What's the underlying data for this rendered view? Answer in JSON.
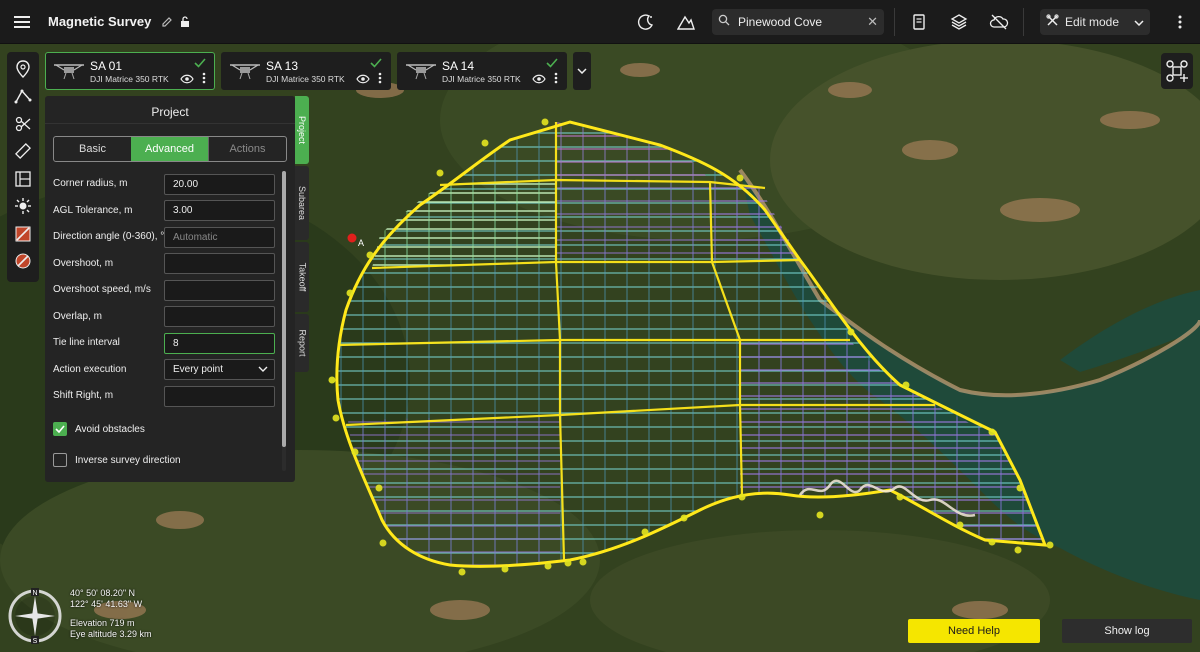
{
  "header": {
    "project_title": "Magnetic Survey",
    "search_value": "Pinewood Cove",
    "edit_mode_label": "Edit mode"
  },
  "icons": {
    "menu": "menu-icon",
    "edit": "pencil-icon",
    "lock": "lock-icon",
    "night": "moon-stars-icon",
    "terrain": "mountain-icon",
    "search": "search-icon",
    "clear": "close-icon",
    "doc": "document-icon",
    "layers": "layers-icon",
    "offline": "cloud-off-icon",
    "edit_mode": "tools-icon",
    "more": "more-vert-icon"
  },
  "drones": [
    {
      "name": "SA 01",
      "model": "DJI Matrice 350 RTK",
      "active": true
    },
    {
      "name": "SA 13",
      "model": "DJI Matrice 350 RTK",
      "active": false
    },
    {
      "name": "SA 14",
      "model": "DJI Matrice 350 RTK",
      "active": false
    }
  ],
  "panel": {
    "title": "Project",
    "tabs": [
      "Basic",
      "Advanced",
      "Actions"
    ],
    "active_tab": "Advanced",
    "fields": {
      "corner_radius": {
        "label": "Corner radius, m",
        "value": "20.00"
      },
      "agl_tolerance": {
        "label": "AGL Tolerance, m",
        "value": "3.00"
      },
      "direction_angle": {
        "label": "Direction angle (0-360), °",
        "placeholder": "Automatic"
      },
      "overshoot": {
        "label": "Overshoot, m",
        "value": ""
      },
      "overshoot_speed": {
        "label": "Overshoot speed, m/s",
        "value": ""
      },
      "overlap": {
        "label": "Overlap, m",
        "value": ""
      },
      "tie_line_interval": {
        "label": "Tie line interval",
        "value": "8"
      },
      "action_execution": {
        "label": "Action execution",
        "value": "Every point"
      },
      "shift_right": {
        "label": "Shift Right, m",
        "value": ""
      }
    },
    "checkboxes": {
      "avoid_obstacles": {
        "label": "Avoid obstacles",
        "checked": true
      },
      "inverse_direction": {
        "label": "Inverse survey direction",
        "checked": false
      }
    }
  },
  "side_tabs": [
    "Project",
    "Subarea",
    "Takeoff",
    "Report"
  ],
  "map": {
    "marker_label": "A",
    "colors": {
      "boundary": "#ffe81a",
      "accent": "#4caf50",
      "water": "#1f4f3c"
    }
  },
  "position": {
    "latitude": "40° 50' 08.20\" N",
    "longitude": "122° 45' 41.63\" W",
    "elevation": "Elevation 719 m",
    "eye_altitude": "Eye altitude 3.29 km"
  },
  "footer": {
    "help_label": "Need Help",
    "log_label": "Show log"
  }
}
